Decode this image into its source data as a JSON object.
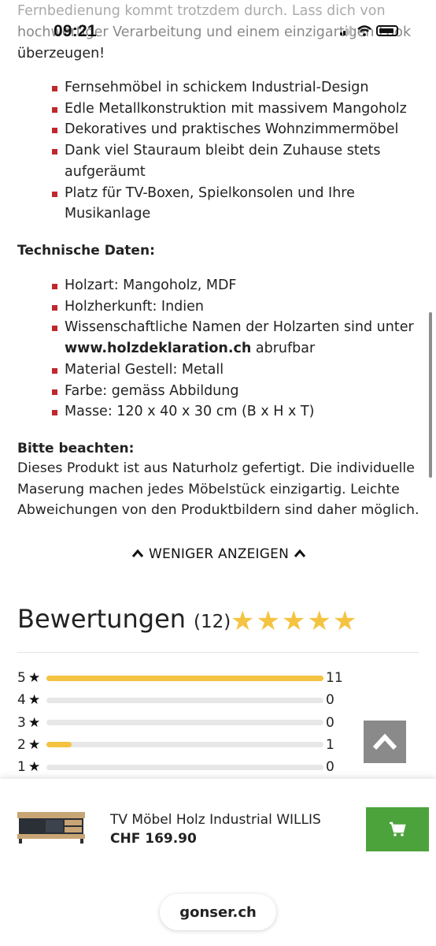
{
  "status": {
    "time": "09:21"
  },
  "intro": {
    "line1": "Fernbedienung kommt trotzdem durch. Lass dich von",
    "line2": "hochwertiger Verarbeitung und einem einzigartigen Look",
    "line3": "überzeugen!"
  },
  "features": [
    "Fernsehmöbel in schickem Industrial-Design",
    "Edle Metallkonstruktion mit massivem Mangoholz",
    "Dekoratives und praktisches Wohnzimmermöbel",
    "Dank viel Stauraum bleibt dein Zuhause stets aufgeräumt",
    "Platz für TV-Boxen, Spielkonsolen und Ihre Musikanlage"
  ],
  "tech": {
    "heading": "Technische Daten:",
    "items": [
      "Holzart: Mangoholz, MDF",
      "Holzherkunft: Indien",
      "Wissenschaftliche Namen der Holzarten sind unter",
      "Material Gestell: Metall",
      "Farbe: gemäss Abbildung",
      "Masse: 120 x 40 x 30 cm (B x H x T)"
    ],
    "link": "www.holzdeklaration.ch",
    "link_suffix": " abrufbar"
  },
  "note": {
    "heading": "Bitte beachten:",
    "text": "Dieses Produkt ist aus Naturholz gefertigt. Die individuelle Maserung machen jedes Möbelstück einzigartig. Leichte Abweichungen von den Produktbildern sind daher möglich."
  },
  "less_button": {
    "label": "WENIGER ANZEIGEN"
  },
  "reviews": {
    "title": "Bewertungen",
    "count": "(12)",
    "stars": 5,
    "rows": [
      {
        "stars": "5",
        "count": "11",
        "fraction": 1.0
      },
      {
        "stars": "4",
        "count": "0",
        "fraction": 0
      },
      {
        "stars": "3",
        "count": "0",
        "fraction": 0
      },
      {
        "stars": "2",
        "count": "1",
        "fraction": 0.09
      },
      {
        "stars": "1",
        "count": "0",
        "fraction": 0
      }
    ]
  },
  "product": {
    "name": "TV Möbel Holz Industrial WILLIS",
    "price": "CHF 169.90"
  },
  "browser": {
    "url": "gonser.ch"
  },
  "colors": {
    "bullet": "#c0282d",
    "star": "#f5c342",
    "cart": "#4ca33c"
  }
}
